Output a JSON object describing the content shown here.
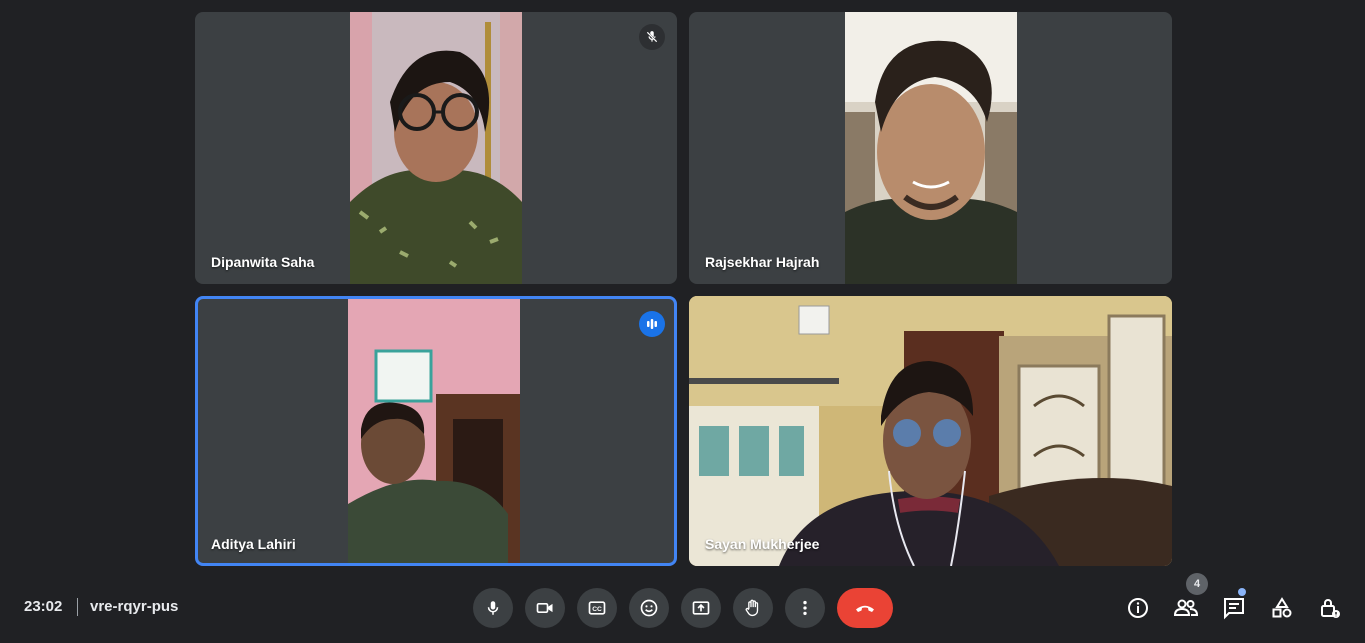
{
  "meeting": {
    "time": "23:02",
    "code": "vre-rqyr-pus",
    "participant_count": "4"
  },
  "participants": [
    {
      "name": "Dipanwita Saha",
      "state": "muted"
    },
    {
      "name": "Rajsekhar Hajrah",
      "state": "normal"
    },
    {
      "name": "Aditya Lahiri",
      "state": "speaking"
    },
    {
      "name": "Sayan Mukherjee",
      "state": "normal"
    }
  ],
  "controls": {
    "center": [
      "microphone-icon",
      "camera-icon",
      "captions-icon",
      "emoji-icon",
      "present-screen-icon",
      "raise-hand-icon",
      "more-options-icon",
      "end-call-icon"
    ],
    "right": [
      "info-icon",
      "people-icon",
      "chat-icon",
      "activities-icon",
      "host-controls-icon"
    ]
  },
  "colors": {
    "background": "#202124",
    "tile": "#3c4043",
    "active_border": "#4285f4",
    "hangup": "#ea4335"
  }
}
